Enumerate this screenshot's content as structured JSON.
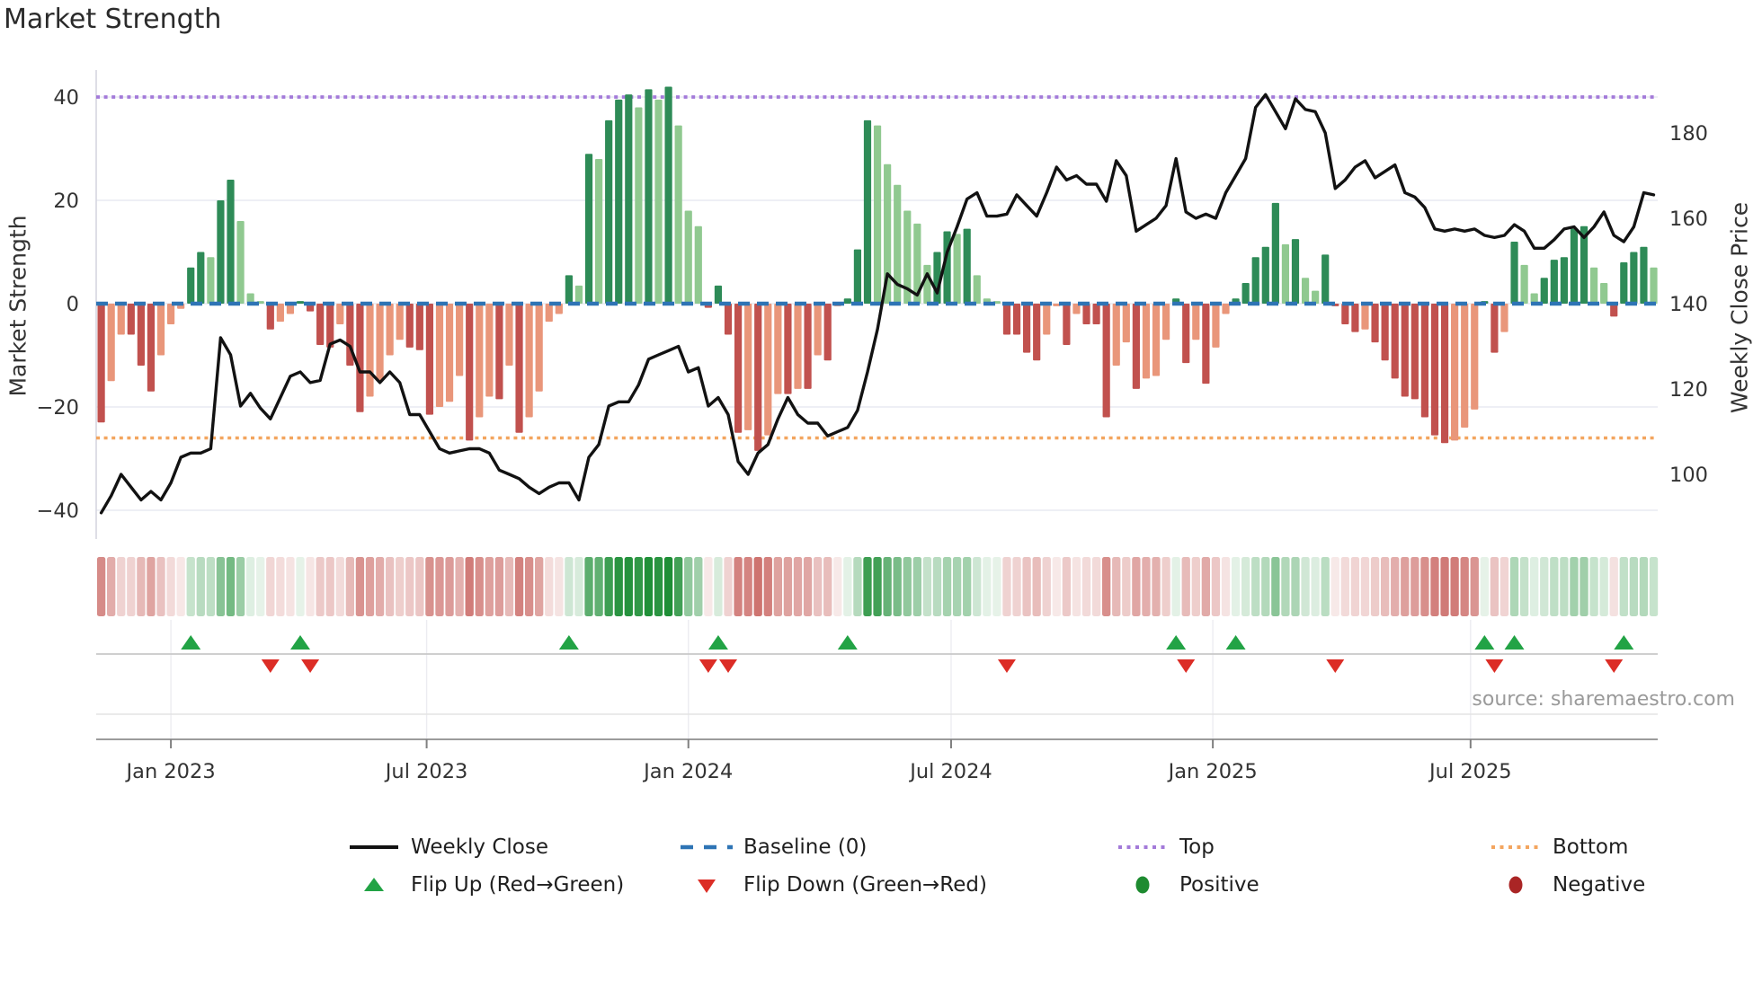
{
  "title": "Market Strength",
  "left_axis_title": "Market Strength",
  "right_axis_title": "Weekly Close Price",
  "source": "source: sharemaestro.com",
  "colors": {
    "bar_pos_strong": "#2e8b57",
    "bar_pos_weak": "#90c990",
    "bar_neg_strong": "#c1514e",
    "bar_neg_weak": "#e9967a",
    "price_line": "#121212",
    "baseline": "#2e74b5",
    "top_line": "#a37ad9",
    "bottom_line": "#f3a55f",
    "flip_up": "#22a345",
    "flip_down": "#dc2d26",
    "positive_dot": "#1e8b30",
    "negative_dot": "#aa2525",
    "grid": "#e8eaf2",
    "spine": "#d4d4de",
    "panel_line_strong": "#9b9b9b",
    "panel_line_mid": "#c8c8c8",
    "panel_line_weak": "#e3e3e3",
    "axis_text": "#333333"
  },
  "legend": {
    "items": [
      {
        "label": "Weekly Close",
        "swatch": "line",
        "color": "price_line"
      },
      {
        "label": "Baseline (0)",
        "swatch": "dashed",
        "color": "baseline"
      },
      {
        "label": "Top",
        "swatch": "dotted",
        "color": "top_line"
      },
      {
        "label": "Bottom",
        "swatch": "dotted",
        "color": "bottom_line"
      },
      {
        "label": "Flip Up (Red→Green)",
        "swatch": "tri-up",
        "color": "flip_up"
      },
      {
        "label": "Flip Down (Green→Red)",
        "swatch": "tri-down",
        "color": "flip_down"
      },
      {
        "label": "Positive",
        "swatch": "ellipse",
        "color": "positive_dot"
      },
      {
        "label": "Negative",
        "swatch": "ellipse",
        "color": "negative_dot"
      }
    ]
  },
  "chart_data": {
    "type": "bar",
    "title": "Market Strength",
    "ylabel_left": "Market Strength",
    "ylabel_right": "Weekly Close Price",
    "baseline_value": 0,
    "top_value": 40,
    "bottom_value": -26,
    "left_axis_ticks": [
      {
        "v": 40,
        "label": "40"
      },
      {
        "v": 20,
        "label": "20"
      },
      {
        "v": 0,
        "label": "0"
      },
      {
        "v": -20,
        "label": "−20"
      },
      {
        "v": -40,
        "label": "−40"
      }
    ],
    "right_axis_ticks": [
      {
        "p": 180,
        "label": "180"
      },
      {
        "p": 160,
        "label": "160"
      },
      {
        "p": 140,
        "label": "140"
      },
      {
        "p": 120,
        "label": "120"
      },
      {
        "p": 100,
        "label": "100"
      }
    ],
    "x_ticks": [
      {
        "week": 7.0,
        "label": "Jan 2023"
      },
      {
        "week": 32.7,
        "label": "Jul 2023"
      },
      {
        "week": 59.0,
        "label": "Jan 2024"
      },
      {
        "week": 85.4,
        "label": "Jul 2024"
      },
      {
        "week": 111.7,
        "label": "Jan 2025"
      },
      {
        "week": 137.6,
        "label": "Jul 2025"
      }
    ],
    "series": [
      {
        "name": "Market Strength",
        "type": "bar",
        "values": [
          -23,
          -15,
          -6,
          -6,
          -12,
          -17,
          -10,
          -4,
          -1,
          7,
          10,
          9,
          20,
          24,
          16,
          2,
          0.5,
          -5,
          -3.5,
          -2,
          0.5,
          -1.5,
          -8,
          -8.5,
          -4,
          -12,
          -21,
          -18,
          -15,
          -10,
          -7,
          -8.5,
          -9,
          -21.5,
          -20,
          -19,
          -14,
          -26.5,
          -22,
          -18,
          -18.5,
          -12,
          -25,
          -22,
          -17,
          -3.5,
          -2,
          5.5,
          3.5,
          29,
          28,
          35.5,
          39.5,
          40.5,
          38,
          41.5,
          39.5,
          42,
          34.5,
          18,
          15,
          -0.8,
          3.5,
          -6,
          -25,
          -24.5,
          -28.5,
          -25.5,
          -17.5,
          -17.5,
          -16.5,
          -16.5,
          -10,
          -11,
          -0.5,
          1,
          10.5,
          35.5,
          34.5,
          27,
          23,
          18,
          15.5,
          7.5,
          10,
          14,
          13.5,
          14.5,
          5.5,
          1,
          0.5,
          -6,
          -6,
          -9.5,
          -11,
          -6,
          -0.5,
          -8,
          -2,
          -4,
          -4,
          -22,
          -12,
          -7.5,
          -16.5,
          -14.5,
          -14,
          -7,
          1,
          -11.5,
          -7,
          -15.5,
          -8.5,
          -2,
          1,
          4,
          9,
          11,
          19.5,
          11.5,
          12.5,
          5,
          2.5,
          9.5,
          -0.5,
          -4,
          -5.5,
          -5,
          -7.5,
          -11,
          -14.5,
          -18,
          -18.5,
          -22,
          -25.5,
          -27,
          -26.5,
          -24,
          -20.5,
          0.5,
          -9.5,
          -5.5,
          12,
          7.5,
          2,
          5,
          8.5,
          9,
          14.5,
          15,
          7,
          4,
          -2.5,
          8,
          10,
          11,
          7
        ]
      },
      {
        "name": "Weekly Close",
        "type": "line",
        "values": [
          91,
          95,
          100,
          97,
          94,
          96,
          94,
          98,
          104,
          105,
          105,
          106,
          132,
          128,
          116,
          119,
          115.5,
          113,
          118,
          123,
          124,
          121.5,
          122,
          130.5,
          131.5,
          130,
          124,
          124,
          121.5,
          124,
          121.5,
          114,
          114,
          110,
          106,
          105,
          105.5,
          106,
          106,
          105,
          101,
          100,
          99,
          97,
          95.5,
          97,
          98,
          98,
          94,
          104,
          107,
          116,
          117,
          117,
          121,
          127,
          128,
          129,
          130,
          124,
          125,
          116,
          118,
          114,
          103,
          100,
          105,
          107,
          113,
          118,
          114,
          112,
          112,
          109,
          110,
          111,
          115,
          124,
          134,
          147,
          144.5,
          143.5,
          142,
          147,
          142.5,
          152,
          158,
          164.5,
          166,
          160.5,
          160.5,
          161,
          165.5,
          163,
          160.5,
          166,
          172,
          169,
          170,
          168,
          168,
          164,
          173.5,
          170,
          157,
          158.5,
          160,
          163,
          174,
          161.5,
          160,
          161,
          160,
          166,
          170,
          174,
          186,
          189,
          185,
          181,
          188,
          185.5,
          185,
          180,
          167,
          169,
          172,
          173.5,
          169.5,
          171,
          172.5,
          166,
          165,
          162.5,
          157.5,
          157,
          157.5,
          157,
          157.5,
          156,
          155.5,
          156,
          158.5,
          157,
          153,
          153,
          155,
          157.5,
          158,
          155.5,
          158,
          161.5,
          156,
          154.5,
          158,
          166,
          165.5
        ]
      }
    ],
    "flip_up_weeks": [
      9,
      20,
      47,
      62,
      75,
      108,
      114,
      139,
      142,
      153
    ],
    "flip_down_weeks": [
      17,
      21,
      61,
      63,
      91,
      109,
      124,
      140,
      152
    ]
  }
}
